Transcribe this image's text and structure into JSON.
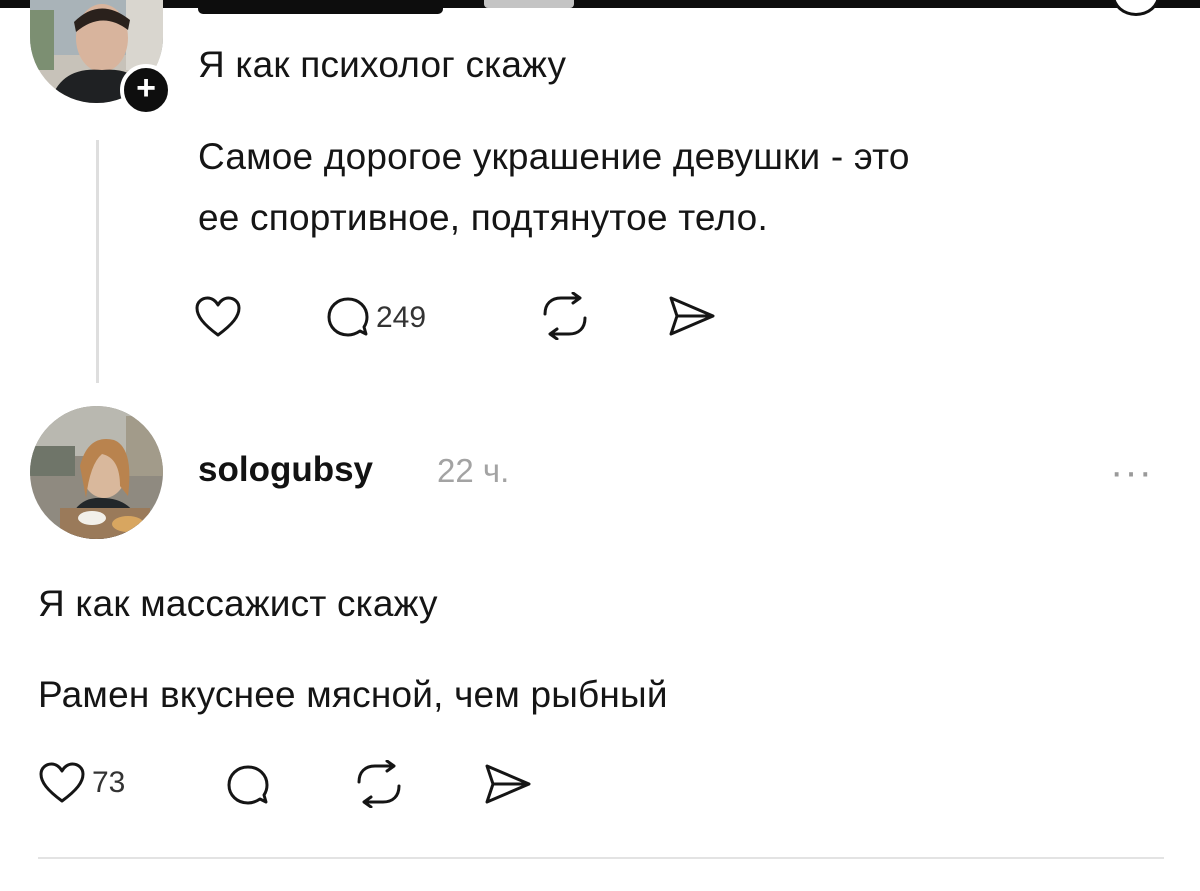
{
  "post1": {
    "title_line": "Я как психолог скажу",
    "body_line1": "Самое дорогое украшение девушки - это",
    "body_line2": "ее спортивное, подтянутое тело.",
    "follow_badge": "+",
    "comments_count": "249"
  },
  "post2": {
    "username": "sologubsy",
    "timestamp": "22 ч.",
    "more": "···",
    "title_line": "Я как массажист скажу",
    "body_line": "Рамен вкуснее мясной, чем рыбный",
    "likes_count": "73"
  },
  "icons": {
    "like": "heart-icon",
    "comment": "speech-bubble-icon",
    "repost": "repost-arrows-icon",
    "share": "paper-plane-icon",
    "follow": "plus-icon",
    "more": "ellipsis-icon"
  },
  "colors": {
    "text": "#151515",
    "muted": "#a3a3a3",
    "thread_line": "#dedede",
    "badge": "#0e0e0e"
  }
}
